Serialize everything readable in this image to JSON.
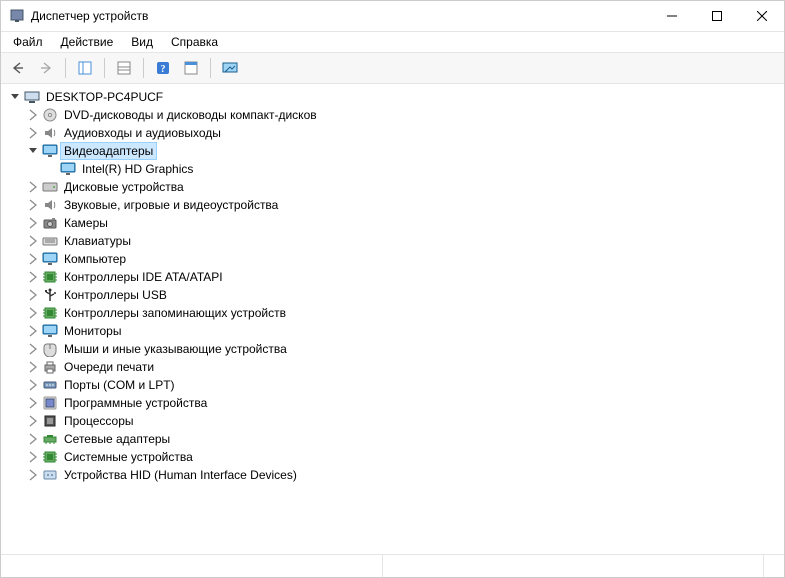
{
  "window": {
    "title": "Диспетчер устройств"
  },
  "menubar": {
    "file": "Файл",
    "action": "Действие",
    "view": "Вид",
    "help": "Справка"
  },
  "tree": {
    "root": "DESKTOP-PC4PUCF",
    "categories": [
      {
        "label": "DVD-дисководы и дисководы компакт-дисков",
        "icon": "disc"
      },
      {
        "label": "Аудиовходы и аудиовыходы",
        "icon": "speaker"
      },
      {
        "label": "Видеоадаптеры",
        "icon": "monitor",
        "expanded": true,
        "selected": true,
        "children": [
          {
            "label": "Intel(R) HD Graphics",
            "icon": "monitor"
          }
        ]
      },
      {
        "label": "Дисковые устройства",
        "icon": "drive"
      },
      {
        "label": "Звуковые, игровые и видеоустройства",
        "icon": "speaker"
      },
      {
        "label": "Камеры",
        "icon": "camera"
      },
      {
        "label": "Клавиатуры",
        "icon": "keyboard"
      },
      {
        "label": "Компьютер",
        "icon": "monitor"
      },
      {
        "label": "Контроллеры IDE ATA/ATAPI",
        "icon": "chip"
      },
      {
        "label": "Контроллеры USB",
        "icon": "usb"
      },
      {
        "label": "Контроллеры запоминающих устройств",
        "icon": "chip"
      },
      {
        "label": "Мониторы",
        "icon": "monitor"
      },
      {
        "label": "Мыши и иные указывающие устройства",
        "icon": "mouse"
      },
      {
        "label": "Очереди печати",
        "icon": "printer"
      },
      {
        "label": "Порты (COM и LPT)",
        "icon": "port"
      },
      {
        "label": "Программные устройства",
        "icon": "software"
      },
      {
        "label": "Процессоры",
        "icon": "cpu"
      },
      {
        "label": "Сетевые адаптеры",
        "icon": "network"
      },
      {
        "label": "Системные устройства",
        "icon": "chip"
      },
      {
        "label": "Устройства HID (Human Interface Devices)",
        "icon": "hid"
      }
    ]
  }
}
